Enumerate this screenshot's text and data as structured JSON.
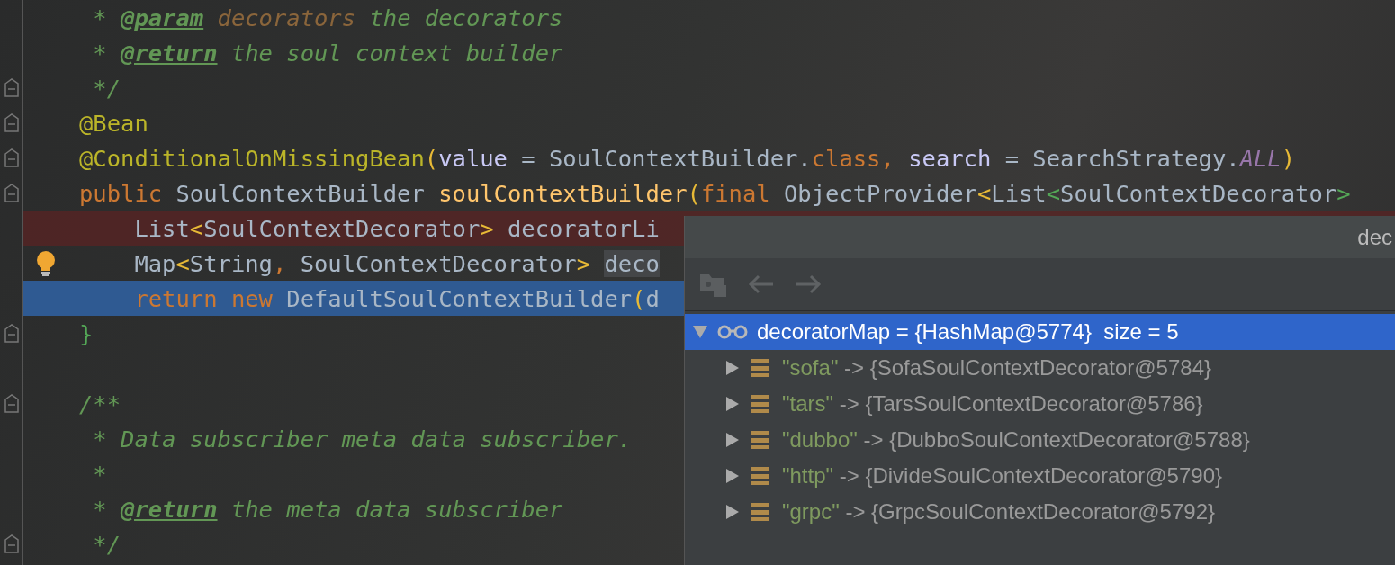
{
  "editor": {
    "lines": [
      {
        "breakpoint": false,
        "current": false,
        "fold_marker": false,
        "bulb": false,
        "tokens": [
          {
            "text": " * ",
            "kind": "comment"
          },
          {
            "text": "@param",
            "kind": "doctag"
          },
          {
            "text": " decorators",
            "kind": "docparam"
          },
          {
            "text": " the decorators",
            "kind": "comment"
          }
        ]
      },
      {
        "breakpoint": false,
        "current": false,
        "fold_marker": false,
        "bulb": false,
        "tokens": [
          {
            "text": " * ",
            "kind": "comment"
          },
          {
            "text": "@return",
            "kind": "doctag"
          },
          {
            "text": " the soul context builder",
            "kind": "comment"
          }
        ]
      },
      {
        "breakpoint": false,
        "current": false,
        "fold_marker": true,
        "bulb": false,
        "tokens": [
          {
            "text": " */",
            "kind": "comment"
          }
        ]
      },
      {
        "breakpoint": false,
        "current": false,
        "fold_marker": true,
        "bulb": false,
        "tokens": [
          {
            "text": "@Bean",
            "kind": "annotation"
          }
        ]
      },
      {
        "breakpoint": false,
        "current": false,
        "fold_marker": true,
        "bulb": false,
        "tokens": [
          {
            "text": "@ConditionalOnMissingBean",
            "kind": "annotation"
          },
          {
            "text": "(",
            "kind": "brace1"
          },
          {
            "text": "value",
            "kind": "param"
          },
          {
            "text": " = SoulContextBuilder.",
            "kind": "plain"
          },
          {
            "text": "class",
            "kind": "keyword"
          },
          {
            "text": ", ",
            "kind": "keyword"
          },
          {
            "text": "search",
            "kind": "param"
          },
          {
            "text": " = SearchStrategy.",
            "kind": "plain"
          },
          {
            "text": "ALL",
            "kind": "constant"
          },
          {
            "text": ")",
            "kind": "brace1"
          }
        ]
      },
      {
        "breakpoint": false,
        "current": false,
        "fold_marker": true,
        "bulb": false,
        "tokens": [
          {
            "text": "public ",
            "kind": "keyword"
          },
          {
            "text": "SoulContextBuilder ",
            "kind": "plain"
          },
          {
            "text": "soulContextBuilder",
            "kind": "method"
          },
          {
            "text": "(",
            "kind": "brace1"
          },
          {
            "text": "final ",
            "kind": "keyword"
          },
          {
            "text": "ObjectProvider",
            "kind": "plain"
          },
          {
            "text": "<",
            "kind": "brace1"
          },
          {
            "text": "List",
            "kind": "plain"
          },
          {
            "text": "<",
            "kind": "brace2"
          },
          {
            "text": "SoulContextDecorator",
            "kind": "plain"
          },
          {
            "text": ">",
            "kind": "brace2"
          }
        ]
      },
      {
        "breakpoint": true,
        "current": false,
        "fold_marker": false,
        "bulb": false,
        "tokens": [
          {
            "text": "    List",
            "kind": "plain"
          },
          {
            "text": "<",
            "kind": "brace1"
          },
          {
            "text": "SoulContextDecorator",
            "kind": "plain"
          },
          {
            "text": ">",
            "kind": "brace1"
          },
          {
            "text": " decoratorLi",
            "kind": "plain"
          }
        ]
      },
      {
        "breakpoint": false,
        "current": false,
        "fold_marker": false,
        "bulb": true,
        "tokens": [
          {
            "text": "    Map",
            "kind": "plain"
          },
          {
            "text": "<",
            "kind": "brace1"
          },
          {
            "text": "String",
            "kind": "plain"
          },
          {
            "text": ",",
            "kind": "keyword"
          },
          {
            "text": " SoulContextDecorator",
            "kind": "plain"
          },
          {
            "text": "> ",
            "kind": "brace1"
          },
          {
            "text": "deco",
            "kind": "usage"
          }
        ]
      },
      {
        "breakpoint": false,
        "current": true,
        "fold_marker": false,
        "bulb": false,
        "tokens": [
          {
            "text": "    return new ",
            "kind": "keyword"
          },
          {
            "text": "DefaultSoulContextBuilder",
            "kind": "plain"
          },
          {
            "text": "(",
            "kind": "brace1"
          },
          {
            "text": "d",
            "kind": "plain"
          }
        ]
      },
      {
        "breakpoint": false,
        "current": false,
        "fold_marker": true,
        "bulb": false,
        "tokens": [
          {
            "text": "}",
            "kind": "brace2"
          }
        ]
      },
      {
        "breakpoint": false,
        "current": false,
        "fold_marker": false,
        "bulb": false
      },
      {
        "breakpoint": false,
        "current": false,
        "fold_marker": true,
        "bulb": false,
        "tokens": [
          {
            "text": "/**",
            "kind": "comment"
          }
        ]
      },
      {
        "breakpoint": false,
        "current": false,
        "fold_marker": false,
        "bulb": false,
        "tokens": [
          {
            "text": " * Data subscriber meta data subscriber.",
            "kind": "comment"
          }
        ]
      },
      {
        "breakpoint": false,
        "current": false,
        "fold_marker": false,
        "bulb": false,
        "tokens": [
          {
            "text": " *",
            "kind": "comment"
          }
        ]
      },
      {
        "breakpoint": false,
        "current": false,
        "fold_marker": false,
        "bulb": false,
        "tokens": [
          {
            "text": " * ",
            "kind": "comment"
          },
          {
            "text": "@return",
            "kind": "doctag"
          },
          {
            "text": " the meta data subscriber",
            "kind": "comment"
          }
        ]
      },
      {
        "breakpoint": false,
        "current": false,
        "fold_marker": true,
        "bulb": false,
        "tokens": [
          {
            "text": " */",
            "kind": "comment"
          }
        ]
      }
    ]
  },
  "popup": {
    "title": "dec",
    "root": {
      "name": "decoratorMap",
      "value": " = {HashMap@5774}  size = 5",
      "expanded": true,
      "selected": true
    },
    "children": [
      {
        "key": "\"sofa\"",
        "value": " -> {SofaSoulContextDecorator@5784}",
        "expanded": false,
        "selected": false
      },
      {
        "key": "\"tars\"",
        "value": " -> {TarsSoulContextDecorator@5786}",
        "expanded": false,
        "selected": false
      },
      {
        "key": "\"dubbo\"",
        "value": " -> {DubboSoulContextDecorator@5788}",
        "expanded": false,
        "selected": false
      },
      {
        "key": "\"http\"",
        "value": " -> {DivideSoulContextDecorator@5790}",
        "expanded": false,
        "selected": false
      },
      {
        "key": "\"grpc\"",
        "value": " -> {GrpcSoulContextDecorator@5792}",
        "expanded": false,
        "selected": false
      }
    ]
  }
}
